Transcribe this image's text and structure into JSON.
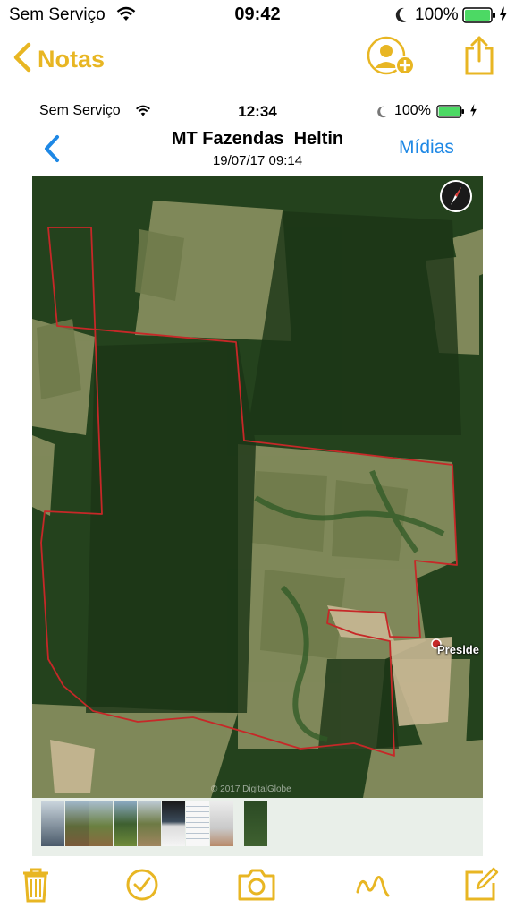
{
  "status_bar": {
    "carrier": "Sem Serviço",
    "time": "09:42",
    "battery_percent": "100%",
    "icons": [
      "wifi-icon",
      "moon-icon",
      "battery-icon",
      "charging-bolt-icon"
    ]
  },
  "nav": {
    "back_label": "Notas",
    "actions": [
      "add-person-icon",
      "share-icon"
    ]
  },
  "embedded_screenshot": {
    "status_bar": {
      "carrier": "Sem Serviço",
      "time": "12:34",
      "battery_percent": "100%"
    },
    "title": "MT Fazendas  Heltin",
    "subtitle": "19/07/17 09:14",
    "media_button": "Mídias",
    "map": {
      "place_label": "Preside",
      "copyright": "© 2017 DigitalGlobe",
      "boundary_color": "#c62828",
      "compass_icon": "compass-icon"
    },
    "thumbnail_count": 9
  },
  "toolbar": {
    "items": [
      "trash-icon",
      "checklist-icon",
      "camera-icon",
      "sketch-icon",
      "compose-icon"
    ],
    "accent_color": "#e8b623"
  }
}
